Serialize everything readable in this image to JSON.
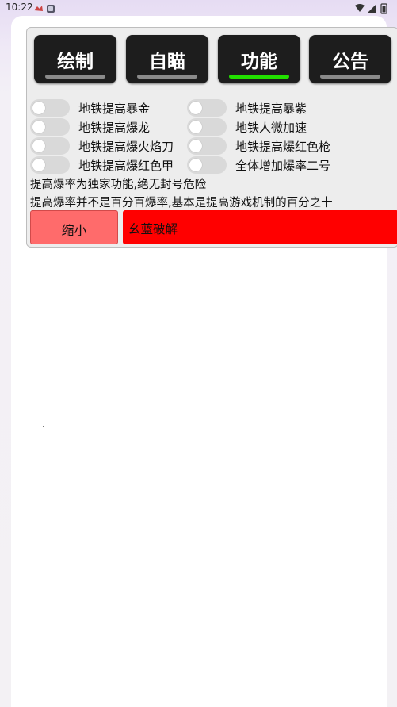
{
  "status_bar": {
    "time": "10:22"
  },
  "colors": {
    "active_indicator": "#22e000",
    "shrink_button": "#ff6b6b",
    "brand_bar": "#ff0000"
  },
  "tabs": [
    {
      "label": "绘制",
      "active": false
    },
    {
      "label": "自瞄",
      "active": false
    },
    {
      "label": "功能",
      "active": true
    },
    {
      "label": "公告",
      "active": false
    }
  ],
  "options": [
    {
      "label": "地铁提高暴金",
      "on": false
    },
    {
      "label": "地铁提高暴紫",
      "on": false
    },
    {
      "label": "地铁提高爆龙",
      "on": false
    },
    {
      "label": "地铁人微加速",
      "on": false
    },
    {
      "label": "地铁提高爆火焰刀",
      "on": false
    },
    {
      "label": "地铁提高爆红色枪",
      "on": false
    },
    {
      "label": "地铁提高爆红色甲",
      "on": false
    },
    {
      "label": "全体增加爆率二号",
      "on": false
    }
  ],
  "notes": [
    "提高爆率为独家功能,绝无封号危险",
    "提高爆率并不是百分百爆率,基本是提高游戏机制的百分之十"
  ],
  "buttons": {
    "shrink_label": "缩小"
  },
  "brand": {
    "label": "幺蓝破解"
  }
}
